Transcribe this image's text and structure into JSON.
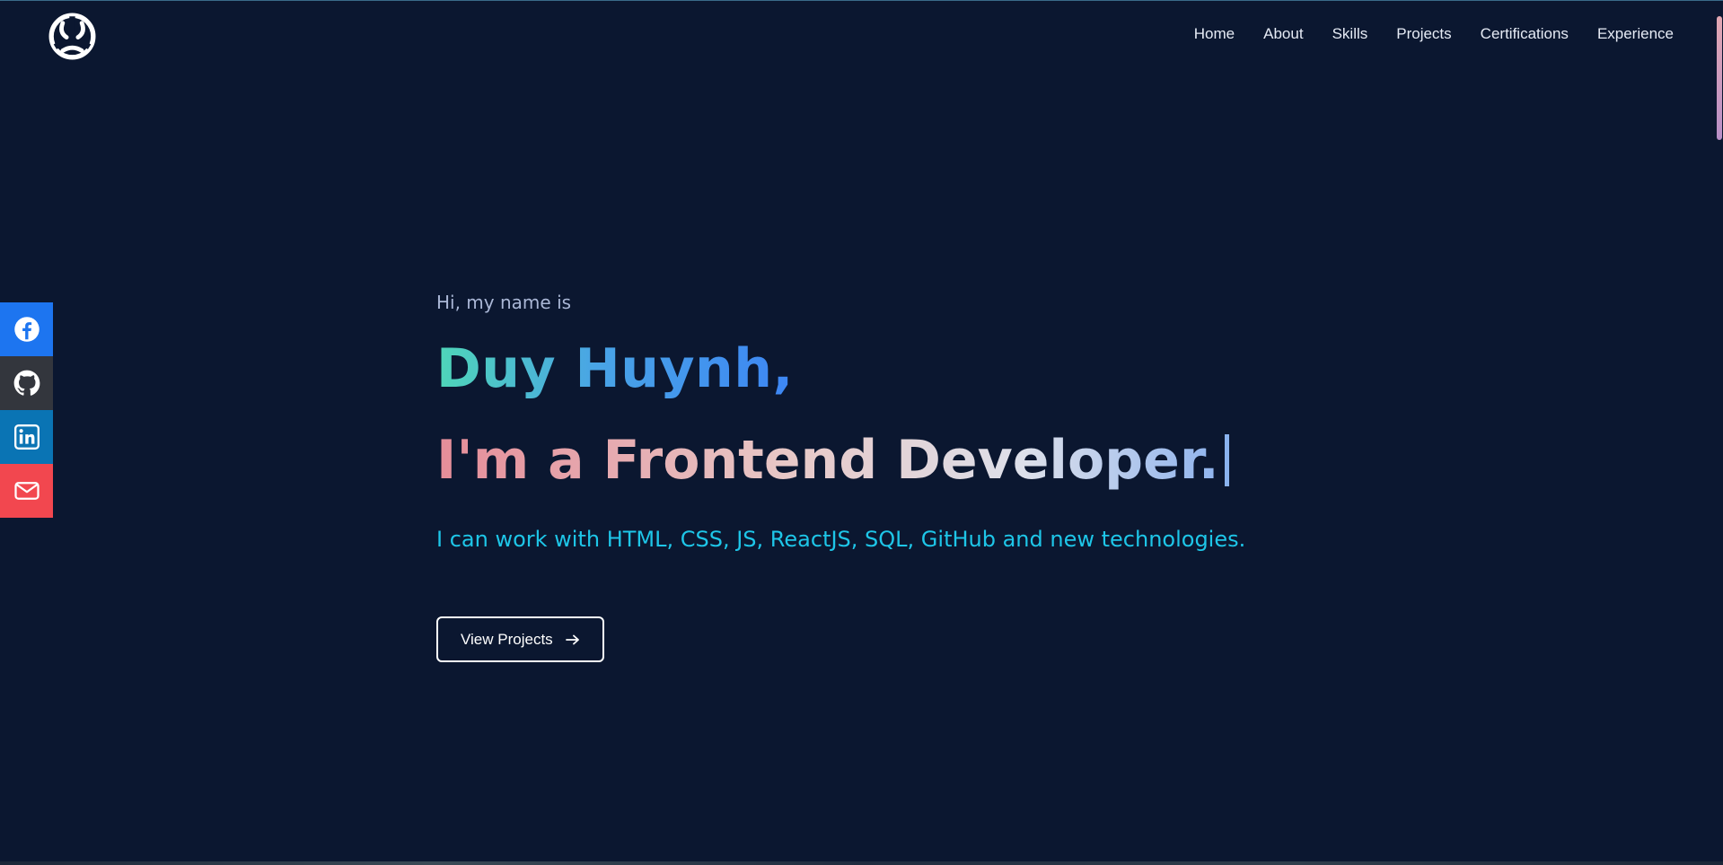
{
  "nav": {
    "items": [
      {
        "label": "Home"
      },
      {
        "label": "About"
      },
      {
        "label": "Skills"
      },
      {
        "label": "Projects"
      },
      {
        "label": "Certifications"
      },
      {
        "label": "Experience"
      }
    ]
  },
  "logo": {
    "icon": "triskelion-logo-icon"
  },
  "social": [
    {
      "icon": "facebook-icon",
      "color": "#1d75f0"
    },
    {
      "icon": "github-icon",
      "color": "#33363d"
    },
    {
      "icon": "linkedin-icon",
      "color": "#0a74b4"
    },
    {
      "icon": "mail-icon",
      "color": "#f2474f"
    }
  ],
  "hero": {
    "greeting": "Hi, my name is",
    "name": "Duy Huynh,",
    "role": "I'm a Frontend Developer.",
    "skills": "I can work with HTML, CSS, JS, ReactJS, SQL, GitHub and new technologies.",
    "button_label": "View Projects",
    "button_icon": "arrow-right-icon"
  },
  "colors": {
    "background": "#0b1730",
    "accent": "#1ec6e8"
  }
}
